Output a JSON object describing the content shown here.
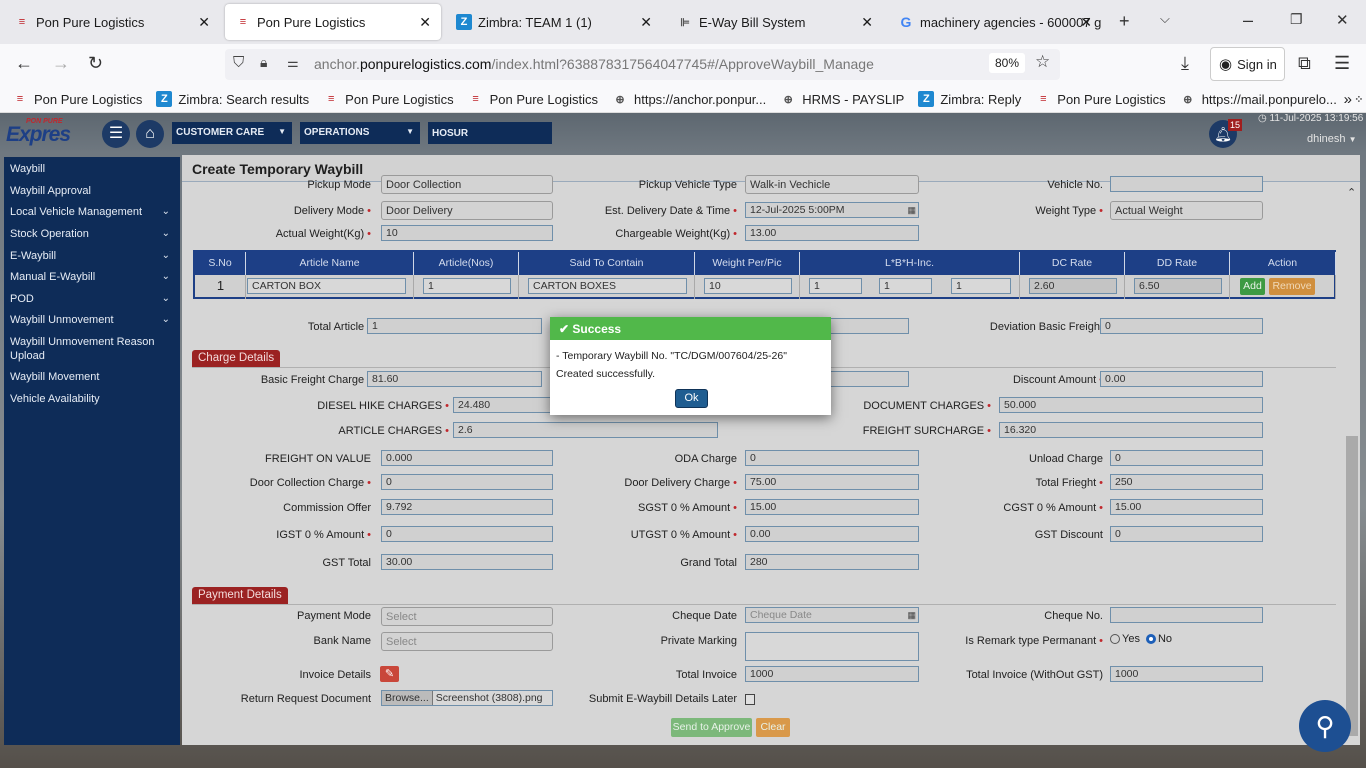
{
  "browser": {
    "tabs": [
      {
        "title": "Pon Pure Logistics",
        "icon": "pp"
      },
      {
        "title": "Pon Pure Logistics",
        "icon": "pp",
        "active": true
      },
      {
        "title": "Zimbra: TEAM 1 (1)",
        "icon": "z"
      },
      {
        "title": "E-Way Bill System",
        "icon": "w"
      },
      {
        "title": "machinery agencies - 600007 g",
        "icon": "g"
      }
    ],
    "url_prefix": "anchor.",
    "url_domain": "ponpurelogistics.com",
    "url_path": "/index.html?638878317564047745#/ApproveWaybill_Manage",
    "zoom": "80%",
    "sign_in": "Sign in",
    "bookmarks": [
      {
        "title": "Pon Pure Logistics",
        "icon": "pp"
      },
      {
        "title": "Zimbra: Search results",
        "icon": "z"
      },
      {
        "title": "Pon Pure Logistics",
        "icon": "pp"
      },
      {
        "title": "Pon Pure Logistics",
        "icon": "pp"
      },
      {
        "title": "https://anchor.ponpur...",
        "icon": "globe"
      },
      {
        "title": "HRMS - PAYSLIP",
        "icon": "globe"
      },
      {
        "title": "Zimbra: Reply",
        "icon": "z"
      },
      {
        "title": "Pon Pure Logistics",
        "icon": "pp"
      },
      {
        "title": "https://mail.ponpurelo...",
        "icon": "globe"
      },
      {
        "title": "trinetra",
        "icon": "dots"
      }
    ]
  },
  "header": {
    "logo_top": "PON PURE",
    "logo_main": "Expres",
    "dropdowns": [
      "CUSTOMER CARE",
      "OPERATIONS"
    ],
    "branch": "HOSUR",
    "notification_count": "15",
    "datetime": "11-Jul-2025 13:19:56",
    "user": "dhinesh"
  },
  "sidebar": [
    {
      "label": "Waybill"
    },
    {
      "label": "Waybill Approval"
    },
    {
      "label": "Local Vehicle Management",
      "expand": true
    },
    {
      "label": "Stock Operation",
      "expand": true
    },
    {
      "label": "E-Waybill",
      "expand": true
    },
    {
      "label": "Manual E-Waybill",
      "expand": true
    },
    {
      "label": "POD",
      "expand": true
    },
    {
      "label": "Waybill Unmovement",
      "expand": true
    },
    {
      "label": "Waybill Unmovement Reason Upload"
    },
    {
      "label": "Waybill Movement"
    },
    {
      "label": "Vehicle Availability"
    }
  ],
  "page_title": "Create Temporary Waybill",
  "top_rows": [
    [
      {
        "label": "Pickup Mode",
        "value": "Door Collection",
        "kind": "sel"
      },
      {
        "label": "Pickup Vehicle Type",
        "value": "Walk-in Vechicle",
        "kind": "sel"
      },
      {
        "label": "Vehicle No.",
        "value": ""
      }
    ],
    [
      {
        "label": "Delivery Mode",
        "req": true,
        "value": "Door Delivery",
        "kind": "sel"
      },
      {
        "label": "Est. Delivery Date & Time",
        "req": true,
        "value": "12-Jul-2025 5:00PM",
        "kind": "date"
      },
      {
        "label": "Weight Type",
        "req": true,
        "value": "Actual Weight",
        "kind": "sel"
      }
    ],
    [
      {
        "label": "Actual Weight(Kg)",
        "req": true,
        "value": "10"
      },
      {
        "label": "Chargeable Weight(Kg)",
        "req": true,
        "value": "13.00"
      },
      null
    ]
  ],
  "article_table": {
    "headers": [
      "S.No",
      "Article Name",
      "Article(Nos)",
      "Said To Contain",
      "Weight Per/Pic",
      "L*B*H-Inc.",
      "DC Rate",
      "DD Rate",
      "Action"
    ],
    "row": {
      "sno": "1",
      "article_name": "CARTON BOX",
      "article_nos": "1",
      "said_to_contain": "CARTON BOXES",
      "weight_per_pic": "10",
      "l": "1",
      "b": "1",
      "h": "1",
      "dc_rate": "2.60",
      "dd_rate": "6.50"
    },
    "add": "Add",
    "remove": "Remove"
  },
  "total_row": [
    {
      "label": "Total Article",
      "req": true,
      "value": "1"
    },
    {
      "label": "",
      "value": ""
    },
    {
      "label": "Deviation Basic Freight",
      "value": "0"
    }
  ],
  "charge_details": {
    "title": "Charge Details",
    "rows": [
      [
        {
          "label": "Basic Freight Charge",
          "req": true,
          "value": "81.60"
        },
        {
          "label": "",
          "value": ""
        },
        {
          "label": "Discount Amount",
          "req": true,
          "value": "0.00"
        }
      ],
      [
        {
          "label": "DIESEL HIKE CHARGES",
          "req": true,
          "value": "24.480"
        },
        {
          "label": "DOCUMENT CHARGES",
          "req": true,
          "value": "50.000"
        }
      ],
      [
        {
          "label": "ARTICLE CHARGES",
          "req": true,
          "value": "2.6"
        },
        {
          "label": "FREIGHT SURCHARGE",
          "req": true,
          "value": "16.320"
        }
      ],
      [
        {
          "label": "FREIGHT ON VALUE",
          "value": "0.000"
        },
        {
          "label": "ODA Charge",
          "value": "0"
        },
        {
          "label": "Unload Charge",
          "value": "0"
        }
      ],
      [
        {
          "label": "Door Collection Charge",
          "req": true,
          "value": "0"
        },
        {
          "label": "Door Delivery Charge",
          "req": true,
          "value": "75.00"
        },
        {
          "label": "Total Frieght",
          "req": true,
          "value": "250"
        }
      ],
      [
        {
          "label": "Commission Offer",
          "value": "9.792"
        },
        {
          "label": "SGST 0 % Amount",
          "req": true,
          "value": "15.00"
        },
        {
          "label": "CGST 0 % Amount",
          "req": true,
          "value": "15.00"
        }
      ],
      [
        {
          "label": "IGST 0 % Amount",
          "req": true,
          "value": "0"
        },
        {
          "label": "UTGST 0 % Amount",
          "req": true,
          "value": "0.00"
        },
        {
          "label": "GST Discount",
          "value": "0"
        }
      ],
      [
        {
          "label": "GST Total",
          "value": "30.00"
        },
        {
          "label": "Grand Total",
          "value": "280"
        },
        null
      ]
    ]
  },
  "payment_details": {
    "title": "Payment Details",
    "payment_mode": {
      "label": "Payment Mode",
      "placeholder": "Select"
    },
    "cheque_date": {
      "label": "Cheque Date",
      "placeholder": "Cheque Date"
    },
    "cheque_no": {
      "label": "Cheque No.",
      "value": ""
    },
    "bank_name": {
      "label": "Bank Name",
      "placeholder": "Select"
    },
    "private_marking": {
      "label": "Private Marking",
      "value": ""
    },
    "remark_permanent": {
      "label": "Is Remark type Permanant",
      "yes": "Yes",
      "no": "No",
      "selected": "No"
    },
    "invoice_details": {
      "label": "Invoice Details"
    },
    "total_invoice": {
      "label": "Total Invoice",
      "value": "1000"
    },
    "total_invoice_wo_gst": {
      "label": "Total Invoice (WithOut GST)",
      "value": "1000"
    },
    "return_doc": {
      "label": "Return Request Document",
      "browse": "Browse...",
      "file": "Screenshot (3808).png"
    },
    "submit_later": {
      "label": "Submit E-Waybill Details Later",
      "checked": false
    },
    "send_button": "Send to Approve",
    "clear_button": "Clear"
  },
  "modal": {
    "title": "Success",
    "message": "- Temporary Waybill No. \"TC/DGM/007604/25-26\" Created successfully.",
    "ok": "Ok"
  }
}
